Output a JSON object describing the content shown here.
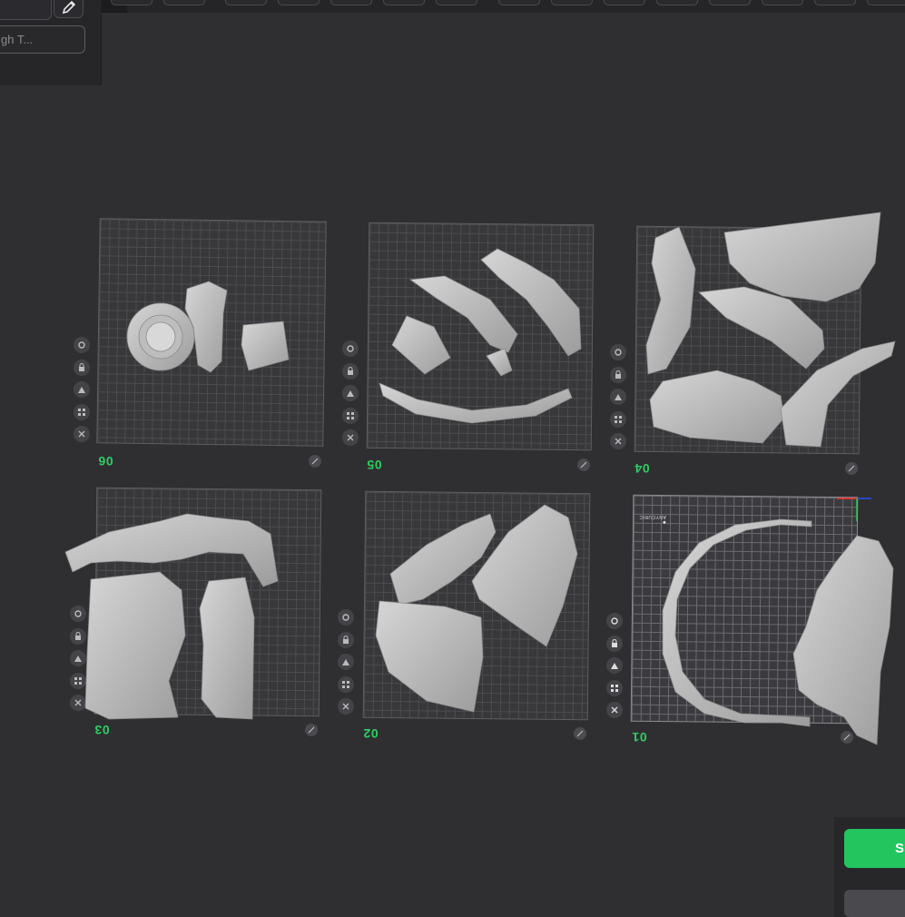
{
  "panel": {
    "name_input_value": "gh T..."
  },
  "plates": [
    {
      "id": "06",
      "label": "06"
    },
    {
      "id": "05",
      "label": "05"
    },
    {
      "id": "04",
      "label": "04"
    },
    {
      "id": "03",
      "label": "03"
    },
    {
      "id": "02",
      "label": "02"
    },
    {
      "id": "01",
      "label": "01",
      "active": true
    }
  ],
  "plate_tools": [
    "settings-icon",
    "lock-icon",
    "auto-orient-icon",
    "arrange-icon",
    "close-icon"
  ],
  "brand_mark": "ANYCUBIC",
  "actions": {
    "slice_label": "Sl"
  },
  "colors": {
    "accent": "#22c55e",
    "plate_label": "#2ecc63",
    "background": "#2f2f32"
  }
}
